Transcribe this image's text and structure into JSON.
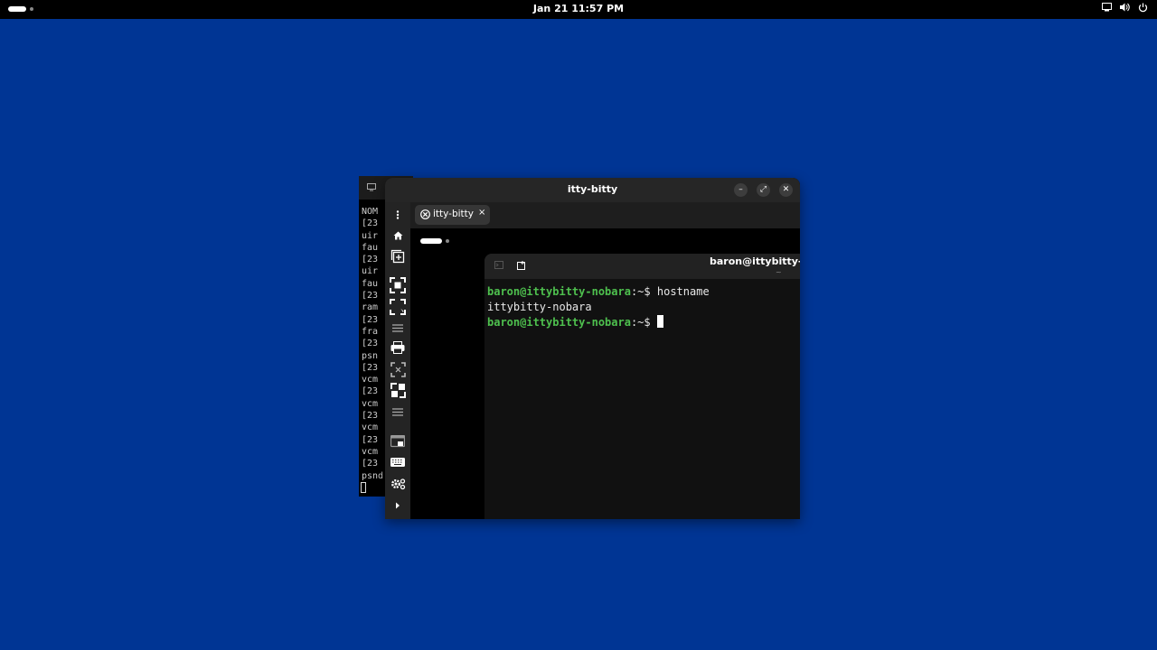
{
  "topbar": {
    "clock": "Jan 21  11:57 PM",
    "tray_icons": [
      "screen-icon",
      "volume-icon",
      "power-icon"
    ]
  },
  "background_window": {
    "lines": [
      "NOM",
      "[23",
      "uir",
      "fau",
      "[23",
      "uir",
      "fau",
      "[23",
      "ram",
      "[23",
      "fra",
      "[23",
      "psn",
      "[23",
      "vcm",
      "[23",
      "vcm",
      "[23",
      "vcm",
      "[23",
      "vcm",
      "[23",
      "psnd"
    ]
  },
  "main_window": {
    "title": "itty-bitty",
    "controls": {
      "minimize": "–",
      "maximize": "⤢",
      "close": "✕"
    },
    "tab": {
      "label": "itty-bitty",
      "close": "×"
    },
    "sidebar_icons": [
      "menu-icon",
      "home-icon",
      "new-window-icon",
      "screenshot-icon",
      "fullscreen-icon",
      "list-icon",
      "print-icon",
      "fit-screen-icon",
      "expand-icon",
      "list-icon",
      "display-icon",
      "keyboard-icon",
      "settings-icon",
      "expand-arrow-icon"
    ]
  },
  "terminal": {
    "title": "baron@ittybitty-",
    "subtitle": "~",
    "lines": [
      {
        "prompt": "baron@ittybitty-nobara",
        "path": ":~$",
        "command": " hostname"
      },
      {
        "output": "ittybitty-nobara"
      },
      {
        "prompt": "baron@ittybitty-nobara",
        "path": ":~$",
        "command": " "
      }
    ]
  },
  "colors": {
    "desktop_background": "#003594",
    "prompt_green": "#4ec04e",
    "terminal_bg": "#111111"
  }
}
